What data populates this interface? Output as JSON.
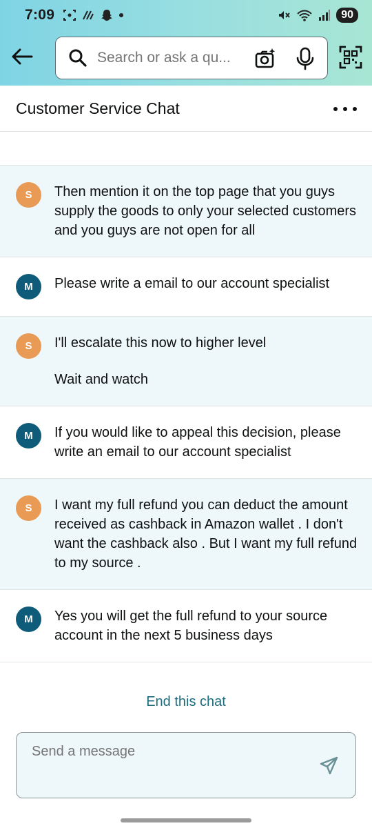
{
  "status_bar": {
    "time": "7:09",
    "battery": "90"
  },
  "search": {
    "placeholder": "Search or ask a qu..."
  },
  "header": {
    "title": "Customer Service Chat"
  },
  "messages": [
    {
      "sender": "support",
      "avatar": "S",
      "paragraphs": [
        "Then mention it on the top page that you guys supply the goods to only your selected customers and you guys are not open for all"
      ]
    },
    {
      "sender": "agent",
      "avatar": "M",
      "paragraphs": [
        "Please write a email to our account specialist"
      ]
    },
    {
      "sender": "support",
      "avatar": "S",
      "paragraphs": [
        "I'll escalate this now to higher level",
        "Wait and watch"
      ]
    },
    {
      "sender": "agent",
      "avatar": "M",
      "paragraphs": [
        "If you would like to appeal this decision, please write an email to our account specialist"
      ]
    },
    {
      "sender": "support",
      "avatar": "S",
      "paragraphs": [
        "I want my full refund you can deduct the amount received as cashback in Amazon wallet . I don't want the cashback also . But I want my full refund to my source ."
      ]
    },
    {
      "sender": "agent",
      "avatar": "M",
      "paragraphs": [
        "Yes you will get the full refund to your source account in the next 5 business days"
      ]
    }
  ],
  "end_chat": "End this chat",
  "composer": {
    "placeholder": "Send a message"
  },
  "colors": {
    "avatar_s": "#e99a55",
    "avatar_m": "#0e5c7a",
    "support_bg": "#eef8fb",
    "link": "#1d6d7e"
  }
}
